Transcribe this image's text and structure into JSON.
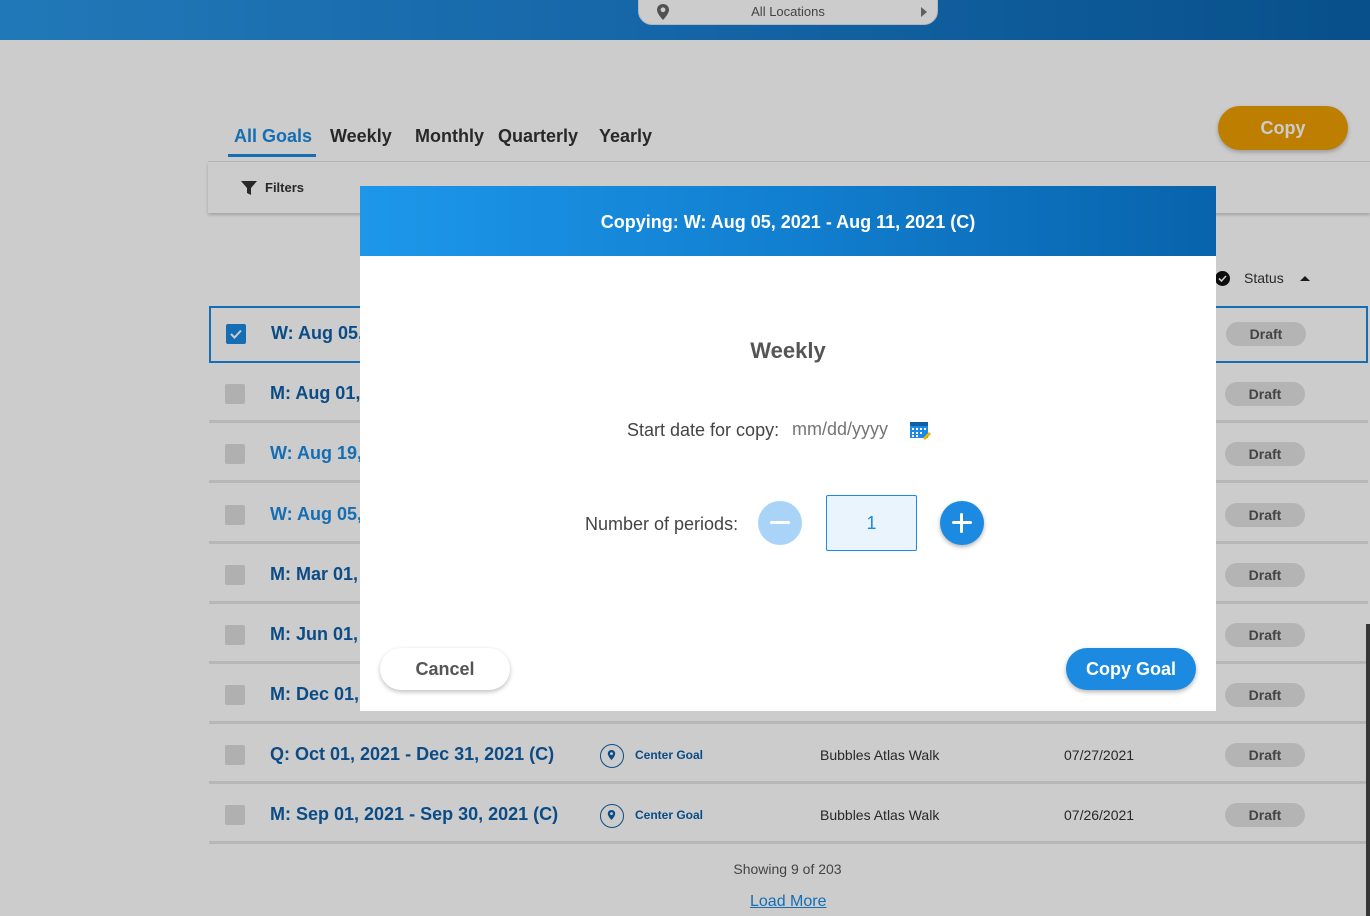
{
  "topbar": {
    "location_label": "All Locations"
  },
  "tabs": [
    {
      "label": "All Goals",
      "active": true
    },
    {
      "label": "Weekly",
      "active": false
    },
    {
      "label": "Monthly",
      "active": false
    },
    {
      "label": "Quarterly",
      "active": false
    },
    {
      "label": "Yearly",
      "active": false
    }
  ],
  "toolbar": {
    "copy_label": "Copy",
    "filters_label": "Filters"
  },
  "table": {
    "status_header": "Status",
    "rows": [
      {
        "title": "W: Aug 05,",
        "selected": true,
        "badge": "Draft"
      },
      {
        "title": "M: Aug 01,",
        "selected": false,
        "badge": "Draft"
      },
      {
        "title": "W: Aug 19,",
        "selected": false,
        "badge": "Draft"
      },
      {
        "title": "W: Aug 05,",
        "selected": false,
        "badge": "Draft"
      },
      {
        "title": "M: Mar 01,",
        "selected": false,
        "badge": "Draft"
      },
      {
        "title": "M: Jun 01,",
        "selected": false,
        "badge": "Draft"
      },
      {
        "title": "M: Dec 01,",
        "selected": false,
        "badge": "Draft"
      },
      {
        "title": "Q: Oct 01, 2021 - Dec 31, 2021 (C)",
        "selected": false,
        "type": "Center Goal",
        "owner": "Bubbles Atlas Walk",
        "date": "07/27/2021",
        "badge": "Draft"
      },
      {
        "title": "M: Sep 01, 2021 - Sep 30, 2021 (C)",
        "selected": false,
        "type": "Center Goal",
        "owner": "Bubbles Atlas Walk",
        "date": "07/26/2021",
        "badge": "Draft"
      }
    ]
  },
  "footer": {
    "showing": "Showing 9 of 203",
    "load_more": "Load More"
  },
  "modal": {
    "title": "Copying: W: Aug 05, 2021 - Aug 11, 2021 (C)",
    "period_name": "Weekly",
    "start_label": "Start date for copy:",
    "start_placeholder": "mm/dd/yyyy",
    "periods_label": "Number of periods:",
    "periods_value": "1",
    "cancel_label": "Cancel",
    "copy_goal_label": "Copy Goal"
  },
  "colors": {
    "accent": "#1b8ae0",
    "copy_button": "#ee9e00"
  }
}
